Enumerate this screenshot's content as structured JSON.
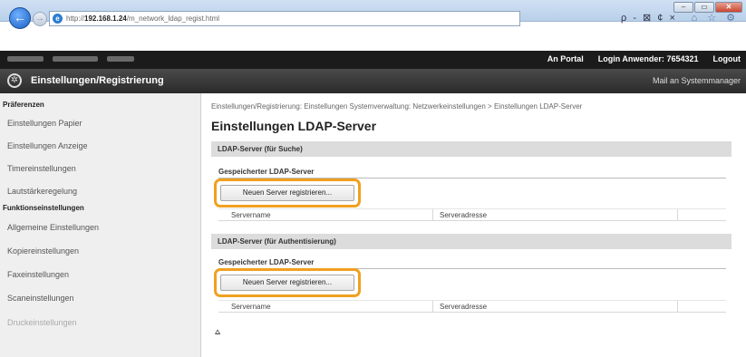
{
  "browser": {
    "url_prefix": "http://",
    "url_host": "192.168.1.24",
    "url_path": "/m_network_ldap_regist.html",
    "addr_tools": "ρ - ⊠ ¢ ×",
    "toolbar_icons": "⌂ ☆ ⚙",
    "win_min": "–",
    "win_max": "▭",
    "win_close": "✕"
  },
  "topbar": {
    "portal_link": "An Portal",
    "login_label": "Login Anwender:",
    "login_user": "7654321",
    "logout_link": "Logout"
  },
  "header": {
    "title": "Einstellungen/Registrierung",
    "mail_link": "Mail an Systemmanager",
    "gear_glyph": "✲"
  },
  "sidebar": {
    "heading_prefs": "Präferenzen",
    "prefs_items": [
      "Einstellungen Papier",
      "Einstellungen Anzeige",
      "Timereinstellungen",
      "Lautstärkeregelung"
    ],
    "heading_functions": "Funktionseinstellungen",
    "function_items": [
      "Allgemeine Einstellungen",
      "Kopiereinstellungen",
      "Faxeinstellungen",
      "Scaneinstellungen",
      "Druckeinstellungen"
    ]
  },
  "main": {
    "breadcrumb": "Einstellungen/Registrierung: Einstellungen Systemverwaltung: Netzwerkeinstellungen > Einstellungen LDAP-Server",
    "page_title": "Einstellungen LDAP-Server",
    "sections": [
      {
        "title": "LDAP-Server (für Suche)",
        "subhead": "Gespeicherter LDAP-Server",
        "button": "Neuen Server registrieren...",
        "col_name": "Servername",
        "col_address": "Serveradresse"
      },
      {
        "title": "LDAP-Server (für Authentisierung)",
        "subhead": "Gespeicherter LDAP-Server",
        "button": "Neuen Server registrieren...",
        "col_name": "Servername",
        "col_address": "Serveradresse"
      }
    ],
    "top_link": "⩟"
  },
  "colors": {
    "highlight": "#f0a020",
    "topbar": "#1b1b1b",
    "section_bar": "#dcdcdc"
  }
}
